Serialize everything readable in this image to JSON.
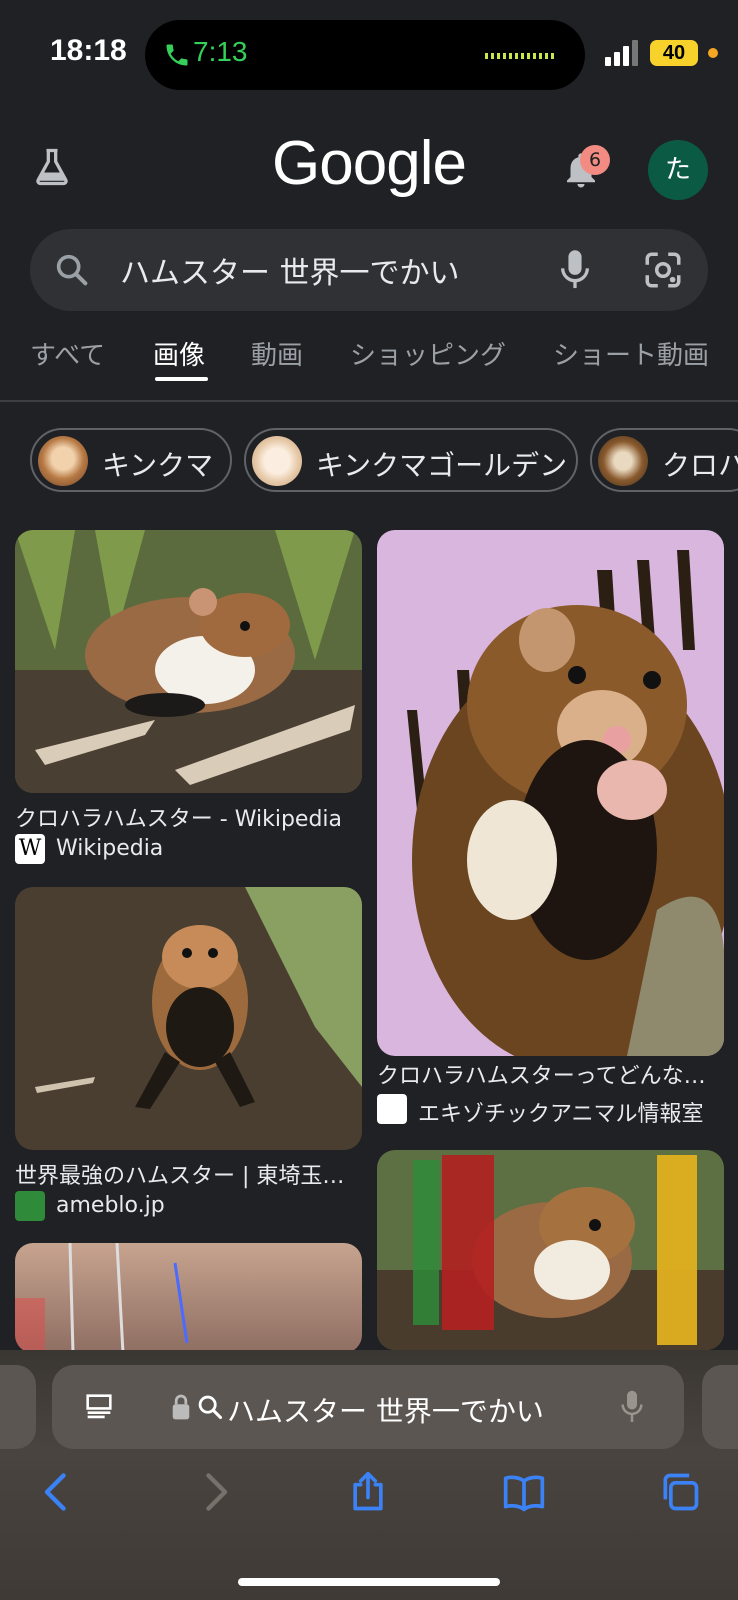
{
  "status": {
    "time": "18:18",
    "call_time": "7:13",
    "battery": "40"
  },
  "header": {
    "logo": "Google",
    "notification_count": "6",
    "avatar_initial": "た"
  },
  "search": {
    "query": "ハムスター 世界一でかい"
  },
  "tabs": [
    {
      "label": "すべて"
    },
    {
      "label": "画像"
    },
    {
      "label": "動画"
    },
    {
      "label": "ショッピング"
    },
    {
      "label": "ショート動画"
    }
  ],
  "chips": [
    {
      "label": "キンクマ"
    },
    {
      "label": "キンクマゴールデン"
    },
    {
      "label": "クロハ"
    }
  ],
  "results": [
    {
      "title": "クロハラハムスター - Wikipedia",
      "source": "Wikipedia",
      "source_icon": "W"
    },
    {
      "title": "クロハラハムスターってどんな…",
      "source": "エキゾチックアニマル情報室"
    },
    {
      "title": "世界最強のハムスター | 東埼玉…",
      "source": "ameblo.jp"
    }
  ],
  "browser": {
    "address": "ハムスター 世界一でかい"
  },
  "colors": {
    "background": "#202124",
    "search_bar": "#303134",
    "badge": "#f28b82",
    "avatar": "#0b5b44",
    "accent_blue": "#3b82f6"
  }
}
